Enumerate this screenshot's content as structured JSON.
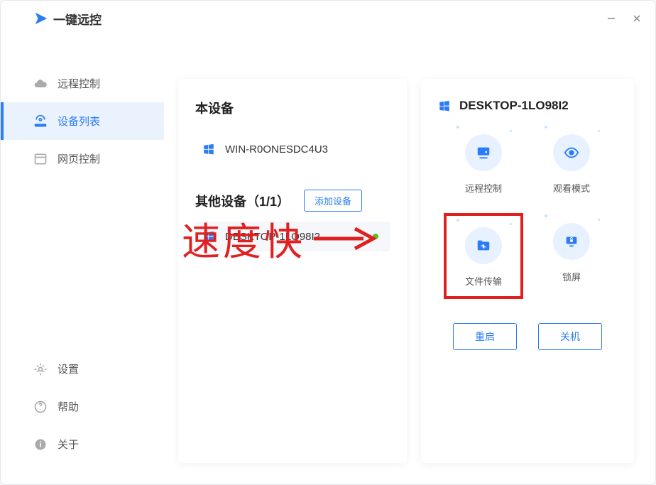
{
  "app_name": "一键远控",
  "sidebar": {
    "nav": [
      {
        "label": "远程控制"
      },
      {
        "label": "设备列表"
      },
      {
        "label": "网页控制"
      }
    ],
    "bottom": [
      {
        "label": "设置"
      },
      {
        "label": "帮助"
      },
      {
        "label": "关于"
      }
    ]
  },
  "left_panel": {
    "this_device_title": "本设备",
    "this_device_name": "WIN-R0ONESDC4U3",
    "other_devices_title": "其他设备（1/1）",
    "add_device_label": "添加设备",
    "other_devices": [
      {
        "name": "DESKTOP-1LO98I2",
        "online": true
      }
    ]
  },
  "right_panel": {
    "device_name": "DESKTOP-1LO98I2",
    "actions": [
      {
        "label": "远程控制"
      },
      {
        "label": "观看模式"
      },
      {
        "label": "文件传输"
      },
      {
        "label": "锁屏"
      }
    ],
    "restart_label": "重启",
    "shutdown_label": "关机"
  },
  "annotation": {
    "text": "速度快"
  }
}
